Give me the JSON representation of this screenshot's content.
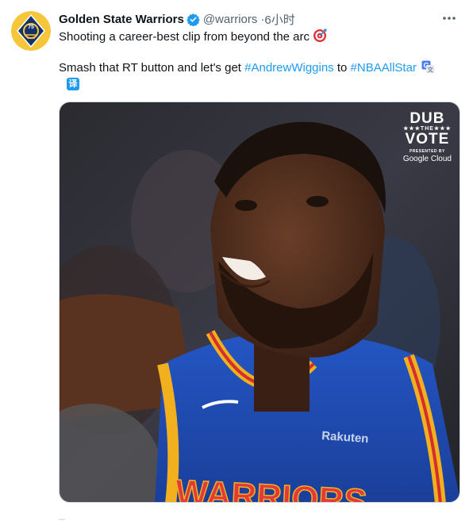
{
  "tweet": {
    "author_name": "Golden State Warriors",
    "handle": "@warriors",
    "separator": "·",
    "time": "6小时",
    "text_line1": "Shooting a career-best clip from beyond the arc",
    "text_line2_prefix": "Smash that RT button and let's get ",
    "hashtag1": "#AndrewWiggins",
    "text_line2_mid": " to ",
    "hashtag2": "#NBAAllStar",
    "translate_label": "译"
  },
  "media": {
    "overlay_dub": "DUB",
    "overlay_the": "★★★THE★★★",
    "overlay_vote": "VOTE",
    "overlay_presented": "PRESENTED BY",
    "overlay_sponsor": "Google Cloud",
    "jersey_text": "WARRIORS",
    "patch_text": "Rakuten"
  },
  "colors": {
    "link": "#1d9bf0",
    "jersey_blue": "#1d4fb8",
    "jersey_trim": "#f2b01e"
  },
  "icons": [
    "team-logo-avatar",
    "verified-badge-icon",
    "more-options-icon",
    "target-emoji-icon",
    "translate-icon"
  ]
}
